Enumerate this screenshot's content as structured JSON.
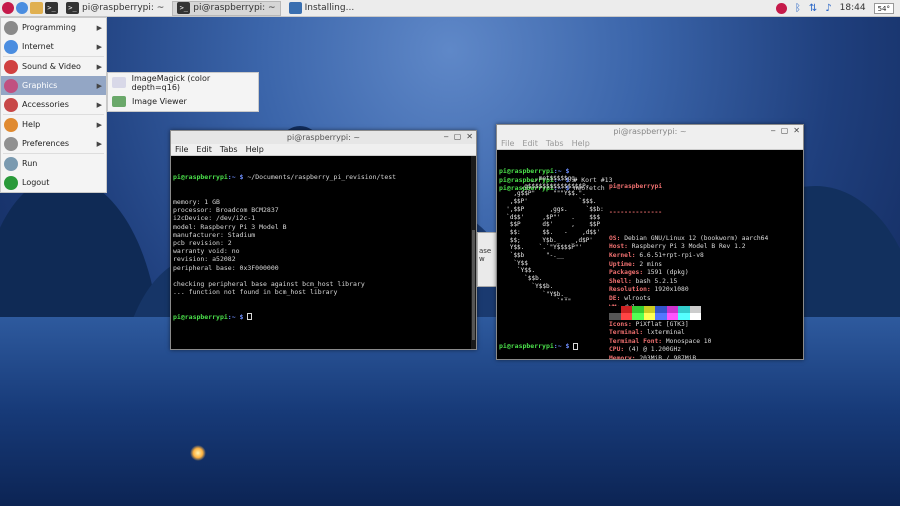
{
  "taskbar": {
    "tasks": [
      {
        "label": "pi@raspberrypi: ~",
        "active": false
      },
      {
        "label": "pi@raspberrypi: ~",
        "active": true
      },
      {
        "label": "Installing...",
        "active": false
      }
    ],
    "clock": "18:44",
    "cpu": "54°"
  },
  "app_menu": {
    "items": [
      {
        "label": "Programming",
        "icon": "programming-icon",
        "submenu": true
      },
      {
        "label": "Internet",
        "icon": "globe-icon",
        "submenu": true
      },
      {
        "label": "Sound & Video",
        "icon": "sound-video-icon",
        "submenu": true
      },
      {
        "label": "Graphics",
        "icon": "graphics-icon",
        "submenu": true,
        "highlighted": true
      },
      {
        "label": "Accessories",
        "icon": "accessories-icon",
        "submenu": true
      },
      {
        "label": "Help",
        "icon": "help-icon",
        "submenu": true
      },
      {
        "label": "Preferences",
        "icon": "preferences-icon",
        "submenu": true
      },
      {
        "label": "Run",
        "icon": "run-icon",
        "submenu": false
      },
      {
        "label": "Logout",
        "icon": "logout-icon",
        "submenu": false
      }
    ],
    "graphics_submenu": [
      {
        "label": "ImageMagick (color depth=q16)",
        "icon": "imagemagick-icon"
      },
      {
        "label": "Image Viewer",
        "icon": "image-viewer-icon"
      }
    ]
  },
  "terminal1": {
    "title": "pi@raspberrypi: ~",
    "menu": [
      "File",
      "Edit",
      "Tabs",
      "Help"
    ],
    "prompt": "pi@raspberrypi",
    "path": ":~ $",
    "command": " ~/Documents/raspberry_pi_revision/test",
    "output": [
      "memory: 1 GB",
      "processor: Broadcom BCM2837",
      "i2cDevice: /dev/i2c-1",
      "model: Raspberry Pi 3 Model B",
      "manufacturer: Stadium",
      "pcb revision: 2",
      "warranty void: no",
      "revision: a52082",
      "peripheral base: 0x3F000000",
      "",
      "checking peripheral base against bcm_host library",
      "... function not found in bcm_host library"
    ]
  },
  "terminal2": {
    "title": "pi@raspberrypi: ~",
    "menu": [
      "File",
      "Edit",
      "Tabs",
      "Help"
    ],
    "lines": [
      {
        "prompt": "pi@raspberrypi",
        "path": ":~ $",
        "cmd": ""
      },
      {
        "prompt": "pi@raspberrypi",
        "path": ":~ $",
        "cmd": " # Kort #13"
      },
      {
        "prompt": "pi@raspberrypi",
        "path": ":~ $",
        "cmd": " neofetch"
      }
    ],
    "art": [
      "         _,met$$$$$gg.",
      "      ,g$$$$$$$$$$$$$$$P.",
      "    ,g$$P\"     \"\"\"Y$$.\".",
      "   ,$$P'              `$$$.",
      "  ',$$P       ,ggs.     `$$b:",
      "  `d$$'     ,$P\"'   .    $$$",
      "   $$P      d$'     ,    $$P",
      "   $$:      $$.   -    ,d$$'",
      "   $$;      Y$b._   _,d$P'",
      "   Y$$.    `.`\"Y$$$$P\"'",
      "   `$$b      \"-.__",
      "    `Y$$",
      "     `Y$$.",
      "       `$$b.",
      "         `Y$$b.",
      "            `\"Y$b._",
      "                `\"\"\""
    ],
    "user_host": "pi@raspberrypi",
    "divider": "--------------",
    "info": [
      {
        "k": "OS",
        "v": "Debian GNU/Linux 12 (bookworm) aarch64"
      },
      {
        "k": "Host",
        "v": "Raspberry Pi 3 Model B Rev 1.2"
      },
      {
        "k": "Kernel",
        "v": "6.6.51+rpt-rpi-v8"
      },
      {
        "k": "Uptime",
        "v": "2 mins"
      },
      {
        "k": "Packages",
        "v": "1591 (dpkg)"
      },
      {
        "k": "Shell",
        "v": "bash 5.2.15"
      },
      {
        "k": "Resolution",
        "v": "1920x1080"
      },
      {
        "k": "DE",
        "v": "wlroots"
      },
      {
        "k": "WM",
        "v": "dwl"
      },
      {
        "k": "Theme",
        "v": "PiXflat [GTK3]"
      },
      {
        "k": "Icons",
        "v": "PiXflat [GTK3]"
      },
      {
        "k": "Terminal",
        "v": "lxterminal"
      },
      {
        "k": "Terminal Font",
        "v": "Monospace 10"
      },
      {
        "k": "CPU",
        "v": "(4) @ 1.200GHz"
      },
      {
        "k": "Memory",
        "v": "203MiB / 987MiB"
      }
    ],
    "palette": [
      "#000000",
      "#cc2222",
      "#33cc33",
      "#cccc22",
      "#3355cc",
      "#cc33cc",
      "#33cccc",
      "#cccccc",
      "#555555",
      "#ff4444",
      "#55ff55",
      "#ffff55",
      "#5577ff",
      "#ff55ff",
      "#55ffff",
      "#ffffff"
    ]
  },
  "peek_window": {
    "text": "ase w"
  }
}
